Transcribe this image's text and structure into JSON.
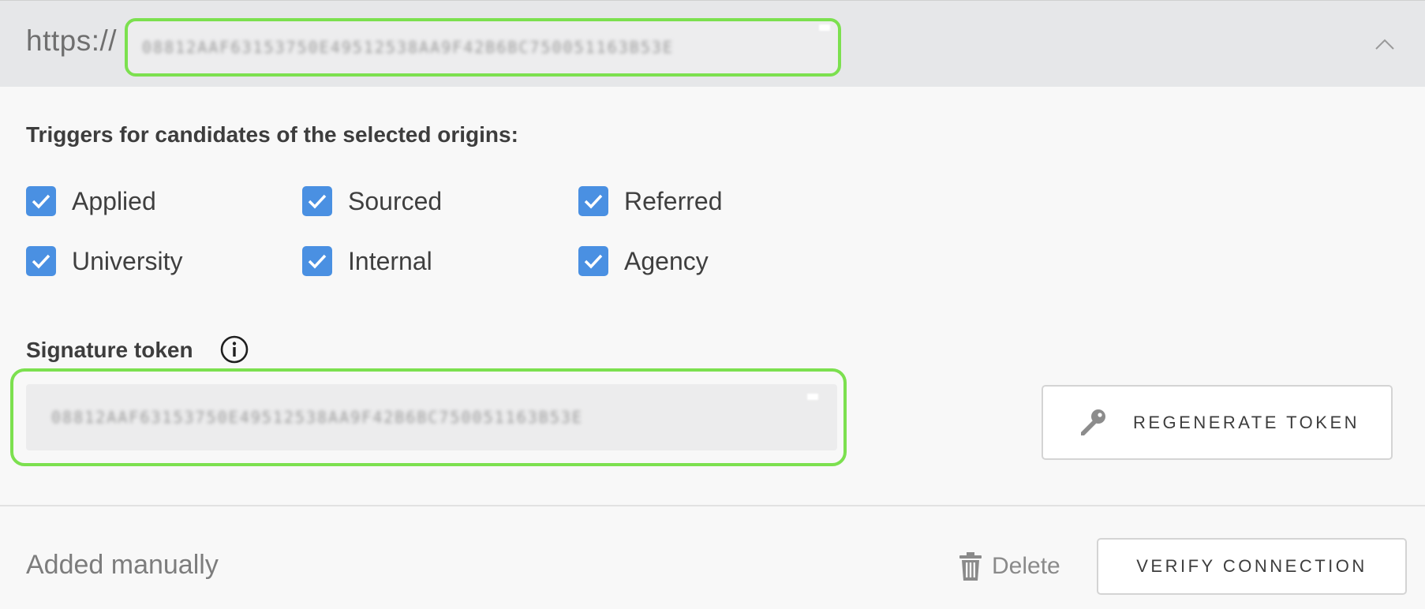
{
  "header": {
    "url_prefix": "https://",
    "url_value": "08812AAF63153750E49512538AA9F42B6BC750051163B53E",
    "collapse_icon": "chevron-up-icon"
  },
  "triggers": {
    "title": "Triggers for candidates of the selected origins:",
    "options": [
      {
        "label": "Applied",
        "checked": true
      },
      {
        "label": "Sourced",
        "checked": true
      },
      {
        "label": "Referred",
        "checked": true
      },
      {
        "label": "University",
        "checked": true
      },
      {
        "label": "Internal",
        "checked": true
      },
      {
        "label": "Agency",
        "checked": true
      }
    ],
    "checkbox_color": "#4a90e2"
  },
  "signature": {
    "title": "Signature token",
    "info_icon": "info-icon",
    "token_value": "08812AAF63153750E49512538AA9F42B6BC750051163B53E",
    "regenerate_label": "REGENERATE TOKEN",
    "regenerate_icon": "key-icon"
  },
  "footer": {
    "added_text": "Added manually",
    "delete_label": "Delete",
    "delete_icon": "trash-icon",
    "verify_label": "VERIFY CONNECTION"
  },
  "colors": {
    "highlight": "#7ce04f",
    "header_bg": "#e6e7e9"
  }
}
